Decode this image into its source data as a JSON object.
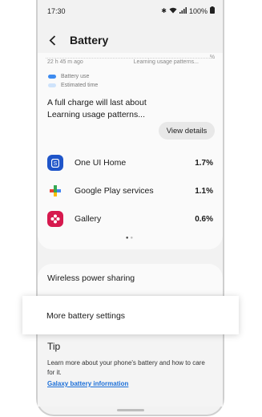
{
  "status": {
    "time": "17:30",
    "battery": "100%"
  },
  "header": {
    "title": "Battery"
  },
  "graph": {
    "left_label": "22 h 45 m ago",
    "right_label": "Learning usage patterns...",
    "top_right": "%"
  },
  "legend": {
    "items": [
      {
        "label": "Battery use",
        "color": "#3d8bf0"
      },
      {
        "label": "Estimated time",
        "color": "#cfe3fb"
      }
    ]
  },
  "charge": {
    "line1": "A full charge will last about",
    "line2": "Learning usage patterns...",
    "view_details_label": "View details"
  },
  "apps": [
    {
      "name": "One UI Home",
      "percent": "1.7%",
      "icon": "one-ui-home-icon",
      "color": "#1f55c9"
    },
    {
      "name": "Google Play services",
      "percent": "1.1%",
      "icon": "google-play-services-icon",
      "color": "#34a853"
    },
    {
      "name": "Gallery",
      "percent": "0.6%",
      "icon": "gallery-icon",
      "color": "#d6194e"
    }
  ],
  "settings": {
    "wireless_power_sharing": "Wireless power sharing",
    "more_battery_settings": "More battery settings"
  },
  "tip": {
    "title": "Tip",
    "body": "Learn more about your phone's battery and how to care for it.",
    "link": "Galaxy battery information"
  }
}
